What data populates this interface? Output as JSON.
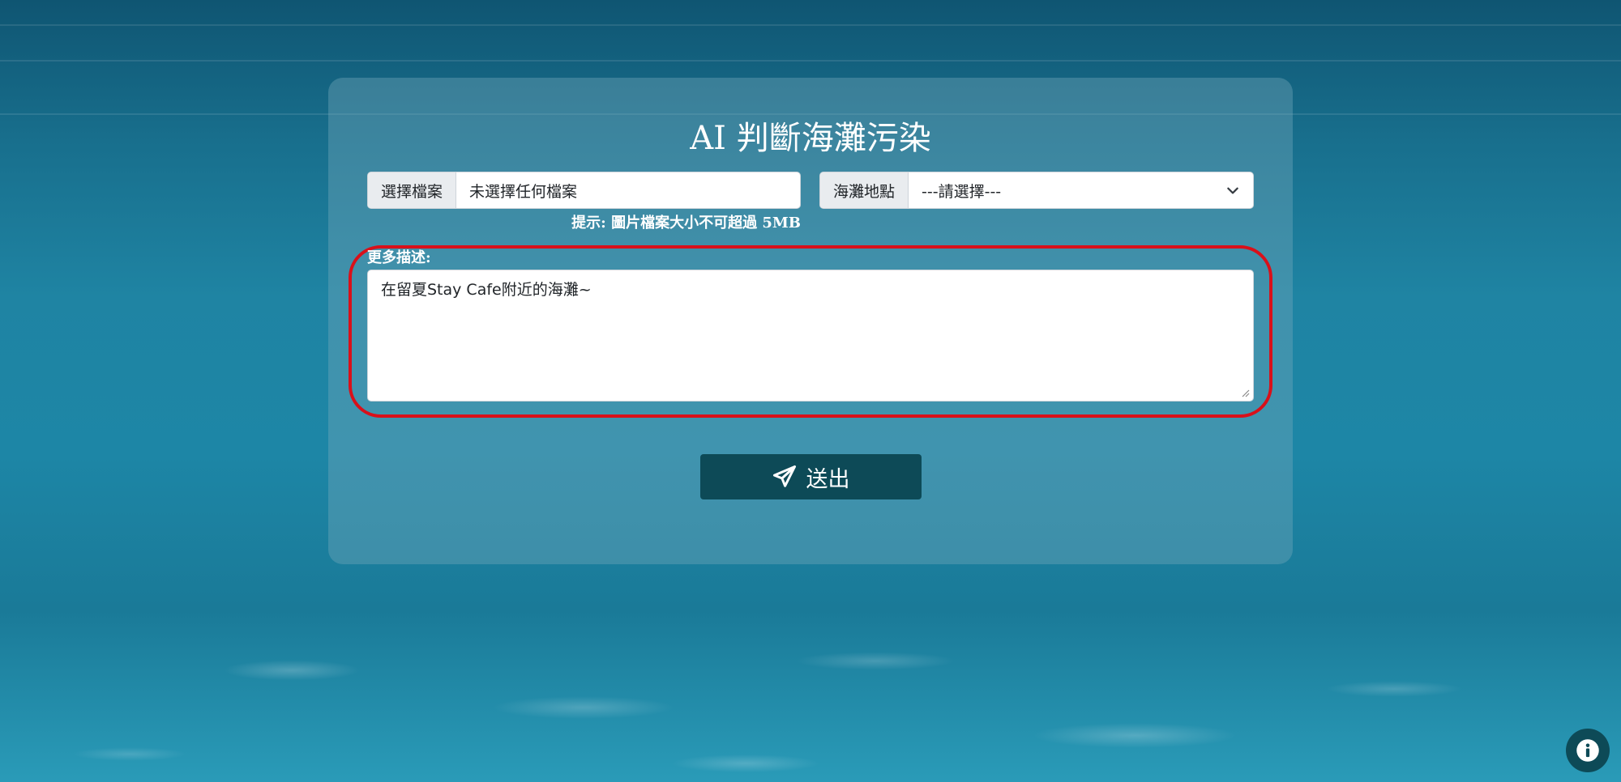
{
  "form": {
    "title": "AI 判斷海灘污染",
    "file_button_label": "選擇檔案",
    "file_status": "未選擇任何檔案",
    "location_label": "海灘地點",
    "location_selected": "---請選擇---",
    "hint": "提示: 圖片檔案大小不可超過 5MB",
    "description_label": "更多描述:",
    "description_value": "在留夏Stay Cafe附近的海灘~",
    "submit_label": "送出"
  },
  "colors": {
    "highlight_ring": "#d9101a",
    "button_bg": "#0d4a57"
  },
  "icons": {
    "submit": "paper-plane-icon",
    "select": "chevron-down-icon",
    "info": "info-icon"
  }
}
